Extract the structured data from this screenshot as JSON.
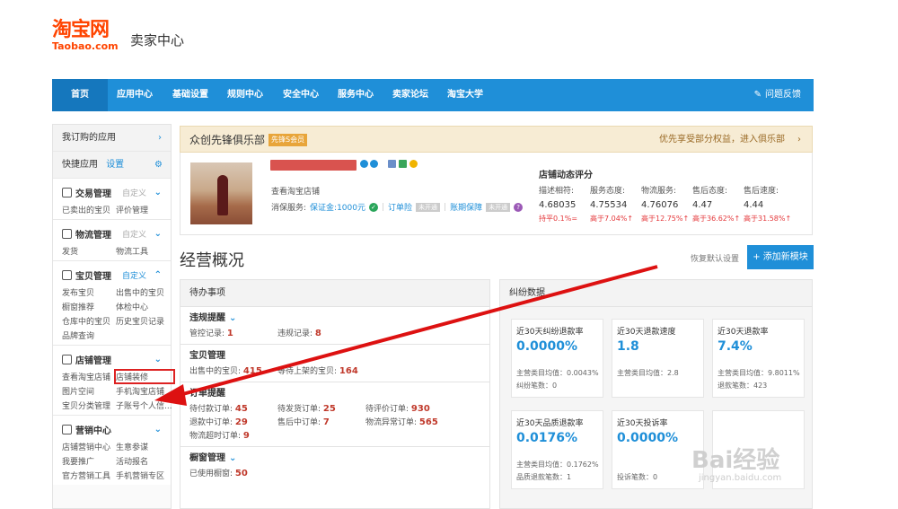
{
  "header": {
    "logo_cn": "淘宝网",
    "logo_en": "Taobao.com",
    "title": "卖家中心"
  },
  "nav": {
    "items": [
      "首页",
      "应用中心",
      "基础设置",
      "规则中心",
      "安全中心",
      "服务中心",
      "卖家论坛",
      "淘宝大学"
    ],
    "feedback": "问题反馈"
  },
  "sidebar": {
    "subscribed": "我订购的应用",
    "quick_apps": "快捷应用",
    "settings_link": "设置",
    "sections": [
      {
        "title": "交易管理",
        "custom": "自定义",
        "links": [
          "已卖出的宝贝",
          "评价管理"
        ]
      },
      {
        "title": "物流管理",
        "custom": "自定义",
        "links": [
          "发货",
          "物流工具"
        ]
      },
      {
        "title": "宝贝管理",
        "custom": "自定义",
        "links": [
          "发布宝贝",
          "出售中的宝贝",
          "橱窗推荐",
          "体检中心",
          "仓库中的宝贝",
          "历史宝贝记录",
          "品牌查询"
        ]
      },
      {
        "title": "店铺管理",
        "custom": "",
        "links": [
          "查看淘宝店铺",
          "店铺装修",
          "图片空间",
          "手机淘宝店铺",
          "宝贝分类管理",
          "子账号个人信..."
        ]
      },
      {
        "title": "营销中心",
        "custom": "",
        "links": [
          "店铺营销中心",
          "生意参谋",
          "我要推广",
          "活动报名",
          "官方营销工具",
          "手机营销专区"
        ]
      }
    ]
  },
  "club": {
    "title": "众创先锋俱乐部",
    "badge": "先锋S会员",
    "right": "优先享受部分权益，进入俱乐部"
  },
  "shop": {
    "view_shop": "查看淘宝店铺",
    "service_label": "消保服务:",
    "deposit": "保证金:1000元",
    "order_insurance": "订单险",
    "account_guarantee": "账期保障",
    "not_enabled": "未开通"
  },
  "dynamic": {
    "title": "店铺动态评分",
    "headers": [
      "描述相符:",
      "服务态度:",
      "物流服务:",
      "售后态度:",
      "售后速度:"
    ],
    "values": [
      "4.68035",
      "4.75534",
      "4.76076",
      "4.47",
      "4.44"
    ],
    "compare": [
      "持平0.1%=",
      "高于7.04%↑",
      "高于12.75%↑",
      "高于36.62%↑",
      "高于31.58%↑"
    ]
  },
  "overview": {
    "title": "经营概况",
    "restore": "恢复默认设置",
    "add_button": "+ 添加新模块"
  },
  "todo": {
    "title": "待办事项",
    "sections": [
      {
        "title": "违规提醒",
        "items": [
          [
            "管控记录:",
            "1"
          ],
          [
            "违规记录:",
            "8"
          ]
        ]
      },
      {
        "title": "宝贝管理",
        "items": [
          [
            "出售中的宝贝:",
            "415"
          ],
          [
            "等待上架的宝贝:",
            "164"
          ]
        ]
      },
      {
        "title": "订单提醒",
        "items": [
          [
            "待付款订单:",
            "45"
          ],
          [
            "待发货订单:",
            "25"
          ],
          [
            "待评价订单:",
            "930"
          ],
          [
            "退款中订单:",
            "29"
          ],
          [
            "售后中订单:",
            "7"
          ],
          [
            "物流异常订单:",
            "565"
          ],
          [
            "物流超时订单:",
            "9"
          ]
        ]
      },
      {
        "title": "橱窗管理",
        "items": [
          [
            "已使用橱窗:",
            "50"
          ]
        ]
      }
    ]
  },
  "dispute": {
    "title": "纠纷数据",
    "cards": [
      {
        "label": "近30天纠纷退款率",
        "value": "0.0000%",
        "sub1": "主营类目均值：0.0043%",
        "sub2": "纠纷笔数：0"
      },
      {
        "label": "近30天退款速度",
        "value": "1.8",
        "sub1": "主营类目均值：2.8",
        "sub2": ""
      },
      {
        "label": "近30天退款率",
        "value": "7.4%",
        "sub1": "主营类目均值：9.8011%",
        "sub2": "退款笔数：423"
      },
      {
        "label": "近30天品质退款率",
        "value": "0.0176%",
        "sub1": "主营类目均值：0.1762%",
        "sub2": "品质退款笔数：1"
      },
      {
        "label": "近30天投诉率",
        "value": "0.0000%",
        "sub1": "投诉笔数：0",
        "sub2": ""
      },
      {
        "label": "",
        "value": "",
        "sub1": "",
        "sub2": ""
      }
    ]
  },
  "watermark": {
    "main": "Bai经验",
    "sub": "jingyan.baidu.com"
  },
  "colors": {
    "nav": "#1f8fd8",
    "accent_orange": "#ff4400",
    "annotation_arrow": "#dd1111"
  }
}
